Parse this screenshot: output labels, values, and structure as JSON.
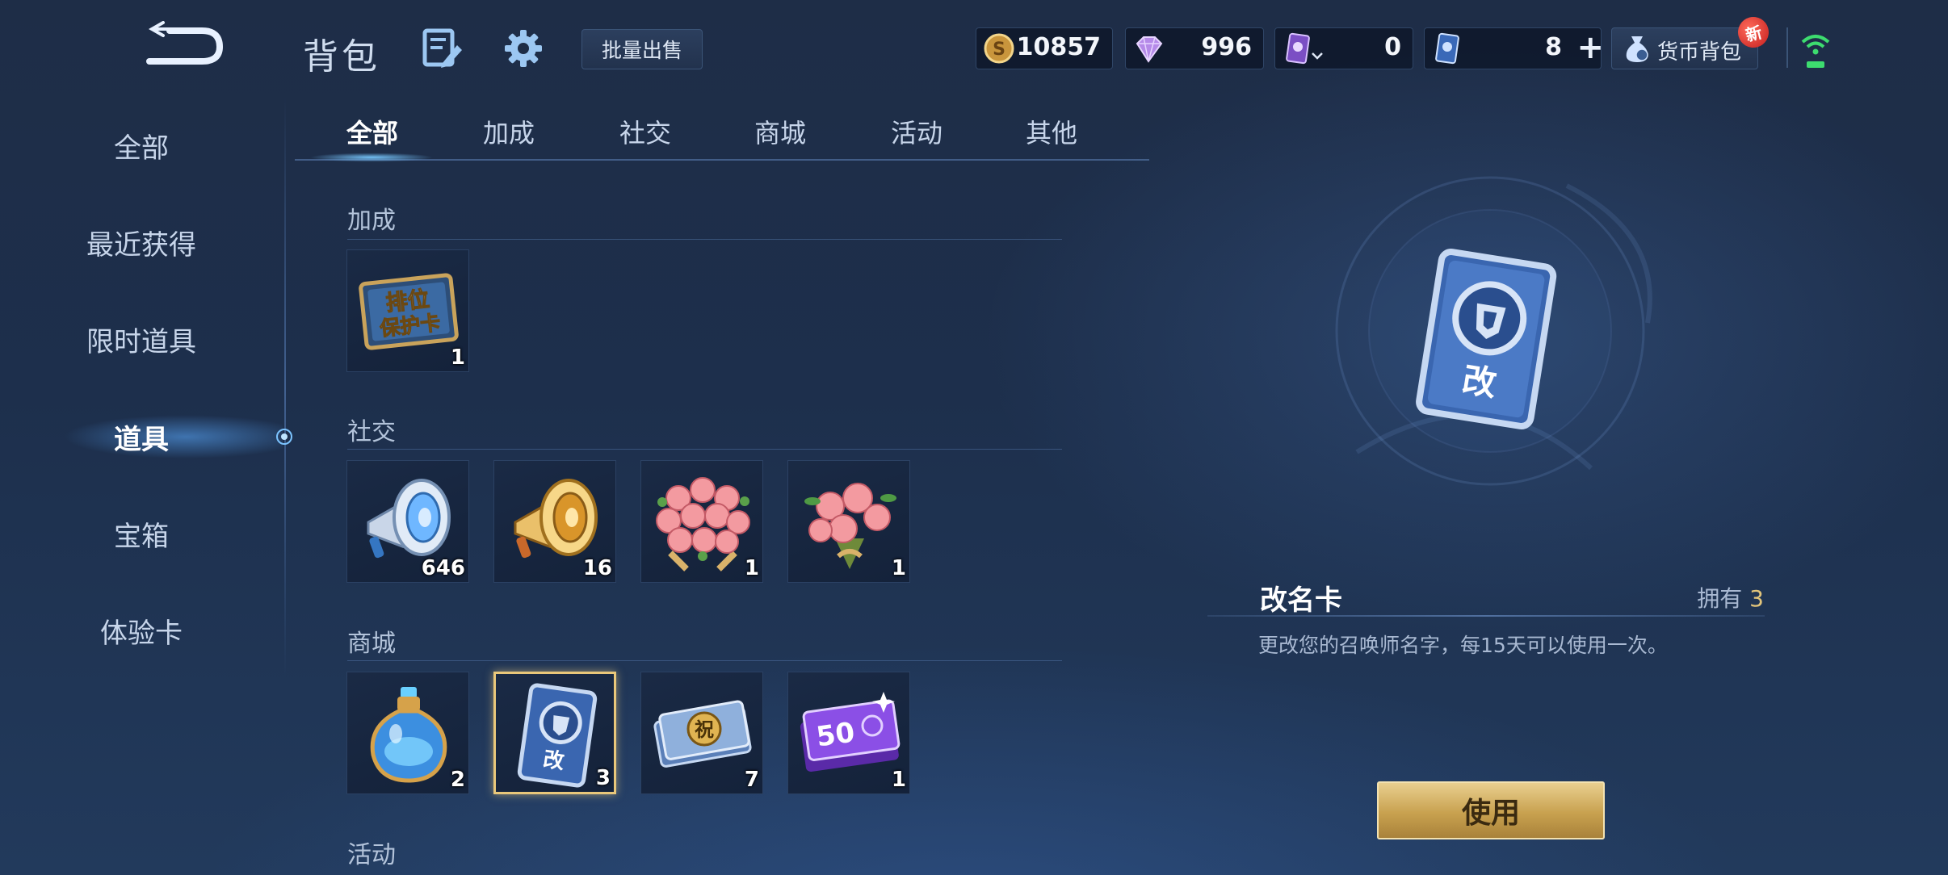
{
  "header": {
    "title": "背包",
    "batch_sell_label": "批量出售",
    "currencies": [
      {
        "name": "gold-coin",
        "value": "10857"
      },
      {
        "name": "diamond",
        "value": "996"
      },
      {
        "name": "purple-card",
        "value": "0"
      },
      {
        "name": "blue-card",
        "value": "8"
      }
    ],
    "wallet_label": "货币背包",
    "new_badge": "新"
  },
  "sidebar": {
    "items": [
      {
        "label": "全部"
      },
      {
        "label": "最近获得"
      },
      {
        "label": "限时道具"
      },
      {
        "label": "道具",
        "active": true
      },
      {
        "label": "宝箱"
      },
      {
        "label": "体验卡"
      }
    ]
  },
  "tabs": [
    {
      "label": "全部",
      "active": true
    },
    {
      "label": "加成"
    },
    {
      "label": "社交"
    },
    {
      "label": "商城"
    },
    {
      "label": "活动"
    },
    {
      "label": "其他"
    }
  ],
  "sections": [
    {
      "title": "加成",
      "items": [
        {
          "icon": "rank-protect-card-icon",
          "icon_text": [
            "排位",
            "保护卡"
          ],
          "count": "1"
        }
      ]
    },
    {
      "title": "社交",
      "items": [
        {
          "icon": "silver-megaphone-icon",
          "count": "646"
        },
        {
          "icon": "gold-megaphone-icon",
          "count": "16"
        },
        {
          "icon": "rose-basket-icon",
          "count": "1"
        },
        {
          "icon": "rose-bouquet-icon",
          "count": "1"
        }
      ]
    },
    {
      "title": "商城",
      "items": [
        {
          "icon": "potion-bottle-icon",
          "count": "2"
        },
        {
          "icon": "rename-card-icon",
          "icon_text": "改",
          "count": "3",
          "selected": true
        },
        {
          "icon": "blessing-ticket-icon",
          "icon_text": "祝",
          "count": "7"
        },
        {
          "icon": "coupon-50-icon",
          "icon_text": "50",
          "count": "1"
        }
      ]
    },
    {
      "title": "活动",
      "items": []
    }
  ],
  "detail": {
    "item_name": "改名卡",
    "own_label": "拥有",
    "own_count": "3",
    "description": "更改您的召唤师名字，每15天可以使用一次。",
    "large_icon_text": "改",
    "use_button": "使用"
  },
  "colors": {
    "background": "#1e2f4b",
    "accent_blue": "#7cc4ff",
    "gold": "#e2c57b",
    "use_button": "#c8a14f"
  }
}
